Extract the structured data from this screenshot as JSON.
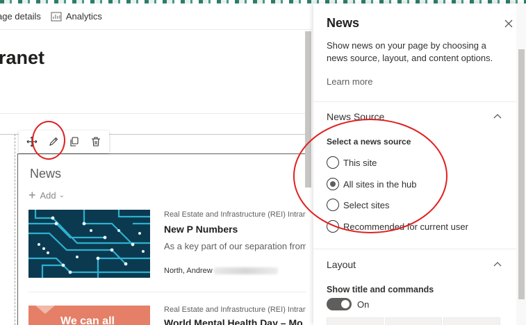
{
  "command_bar": {
    "page_details_label": "age details",
    "analytics_label": "Analytics"
  },
  "page": {
    "title": "ranet"
  },
  "web_part": {
    "heading": "News",
    "add_label": "Add",
    "items": [
      {
        "source": "Real Estate and Infrastructure (REI) Intranet",
        "title": "New P Numbers",
        "description": "As a key part of our separation from",
        "author": "North, Andrew"
      },
      {
        "source": "Real Estate and Infrastructure (REI) Intranet",
        "title": "World Mental Health Day – Mo",
        "image_text": "We can all"
      }
    ]
  },
  "property_pane": {
    "title": "News",
    "description": "Show news on your page by choosing a news source, layout, and content options.",
    "learn_more": "Learn more",
    "news_source": {
      "group_label": "News Source",
      "select_label": "Select a news source",
      "options": [
        {
          "label": "This site",
          "selected": false
        },
        {
          "label": "All sites in the hub",
          "selected": true
        },
        {
          "label": "Select sites",
          "selected": false
        },
        {
          "label": "Recommended for current user",
          "selected": false
        }
      ]
    },
    "layout": {
      "group_label": "Layout",
      "show_title_label": "Show title and commands",
      "toggle_state": "On"
    }
  },
  "colors": {
    "annotation_red": "#e02020",
    "toggle_on": "#605e5c",
    "thumbnail_teal": "#0c3a4e",
    "thumbnail_coral": "#e57f68"
  }
}
